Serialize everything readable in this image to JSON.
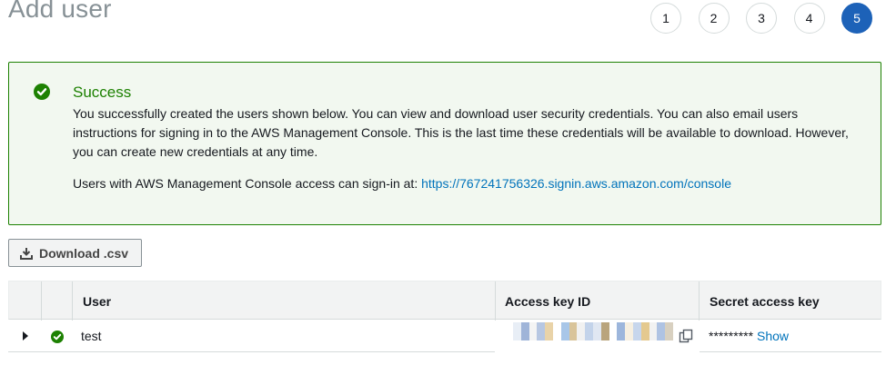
{
  "page": {
    "title": "Add user"
  },
  "steps": [
    {
      "label": "1",
      "active": false
    },
    {
      "label": "2",
      "active": false
    },
    {
      "label": "3",
      "active": false
    },
    {
      "label": "4",
      "active": false
    },
    {
      "label": "5",
      "active": true
    }
  ],
  "alert": {
    "title": "Success",
    "body": "You successfully created the users shown below. You can view and download user security credentials. You can also email users instructions for signing in to the AWS Management Console. This is the last time these credentials will be available to download. However, you can create new credentials at any time.",
    "signin_prefix": "Users with AWS Management Console access can sign-in at: ",
    "signin_url": "https://767241756326.signin.aws.amazon.com/console"
  },
  "toolbar": {
    "download_label": "Download .csv"
  },
  "table": {
    "columns": [
      "User",
      "Access key ID",
      "Secret access key"
    ],
    "rows": [
      {
        "user": "test",
        "secret_mask": "*********",
        "show_label": "Show",
        "status": "success"
      }
    ]
  },
  "colors": {
    "success": "#1d8102",
    "alert_bg": "#f2f8f0",
    "link": "#0073bb",
    "active_step": "#1d62b8",
    "title_grey": "#879196"
  },
  "icons": {
    "alert": "check-circle-icon",
    "download": "download-icon",
    "expand": "caret-right-icon",
    "row_status": "check-circle-icon",
    "copy": "copy-icon"
  }
}
